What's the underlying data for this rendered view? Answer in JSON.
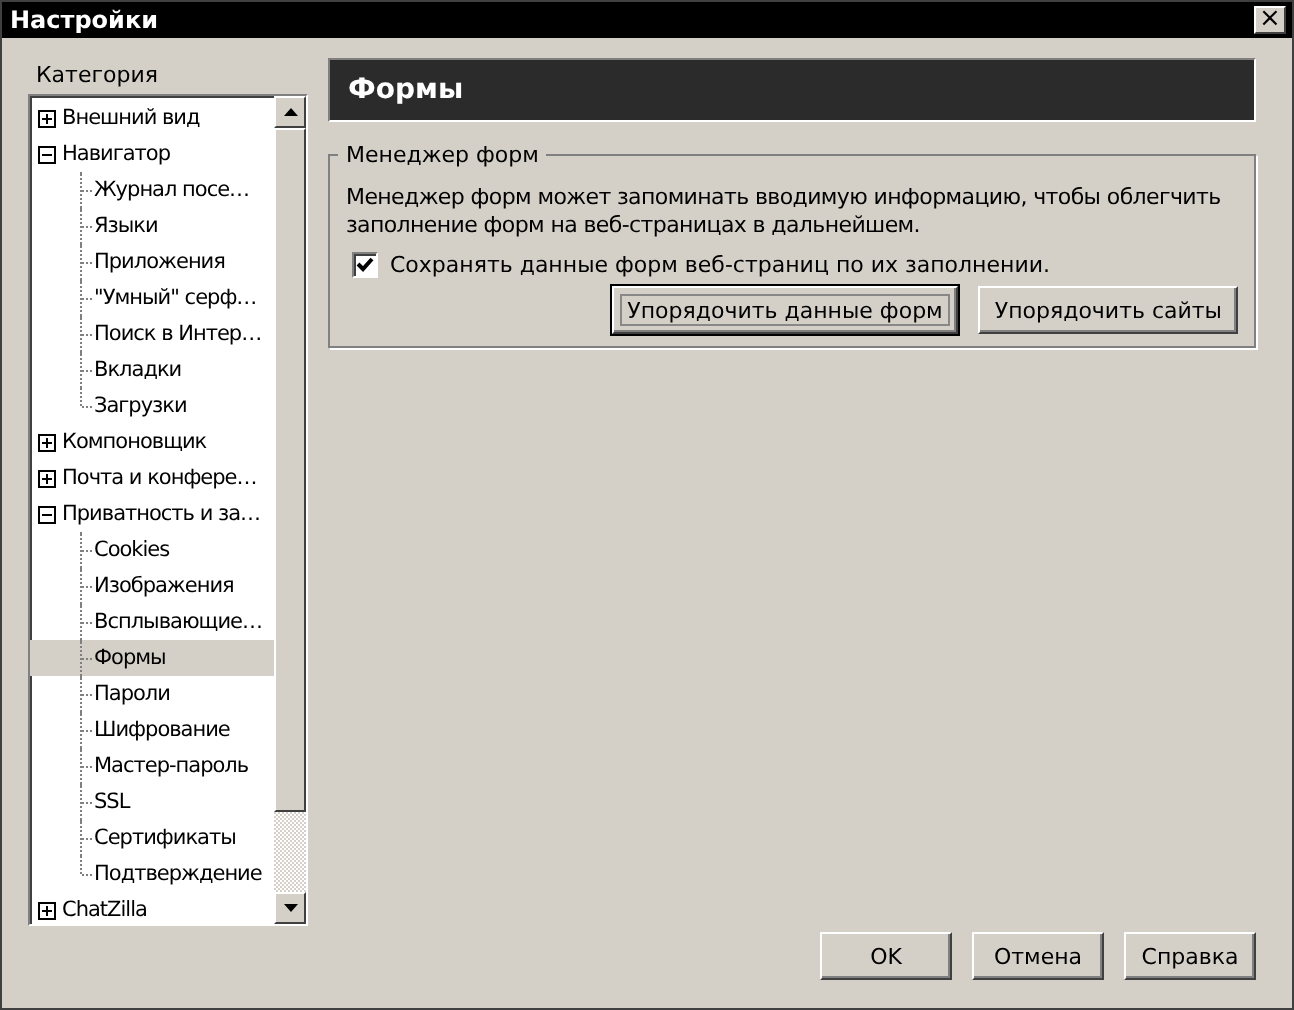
{
  "window": {
    "title": "Настройки",
    "close": "×"
  },
  "sidebar": {
    "label": "Категория",
    "items": [
      {
        "label": "Внешний вид",
        "expanded": false,
        "selected": false
      },
      {
        "label": "Навигатор",
        "expanded": true,
        "selected": false,
        "children": [
          {
            "label": "Журнал посе…",
            "selected": false
          },
          {
            "label": "Языки",
            "selected": false
          },
          {
            "label": "Приложения",
            "selected": false
          },
          {
            "label": "\"Умный\" серф…",
            "selected": false
          },
          {
            "label": "Поиск в Интер…",
            "selected": false
          },
          {
            "label": "Вкладки",
            "selected": false
          },
          {
            "label": "Загрузки",
            "selected": false
          }
        ]
      },
      {
        "label": "Компоновщик",
        "expanded": false,
        "selected": false
      },
      {
        "label": "Почта и конфере…",
        "expanded": false,
        "selected": false
      },
      {
        "label": "Приватность и за…",
        "expanded": true,
        "selected": false,
        "children": [
          {
            "label": "Cookies",
            "selected": false
          },
          {
            "label": "Изображения",
            "selected": false
          },
          {
            "label": "Всплывающие…",
            "selected": false
          },
          {
            "label": "Формы",
            "selected": true
          },
          {
            "label": "Пароли",
            "selected": false
          },
          {
            "label": "Шифрование",
            "selected": false
          },
          {
            "label": "Мастер-пароль",
            "selected": false
          },
          {
            "label": "SSL",
            "selected": false
          },
          {
            "label": "Сертификаты",
            "selected": false
          },
          {
            "label": "Подтверждение",
            "selected": false
          }
        ]
      },
      {
        "label": "ChatZilla",
        "expanded": false,
        "selected": false
      }
    ]
  },
  "panel": {
    "title": "Формы",
    "group": {
      "legend": "Менеджер форм",
      "description": "Менеджер форм может запоминать вводимую информацию, чтобы облегчить заполнение форм на веб-страницах в дальнейшем.",
      "checkbox": {
        "label": "Сохранять данные форм веб-страниц по их заполнении.",
        "checked": true
      },
      "buttons": [
        {
          "label": "Упорядочить данные форм",
          "focused": true
        },
        {
          "label": "Упорядочить сайты",
          "focused": false
        }
      ]
    }
  },
  "buttons": [
    "OK",
    "Отмена",
    "Справка"
  ]
}
